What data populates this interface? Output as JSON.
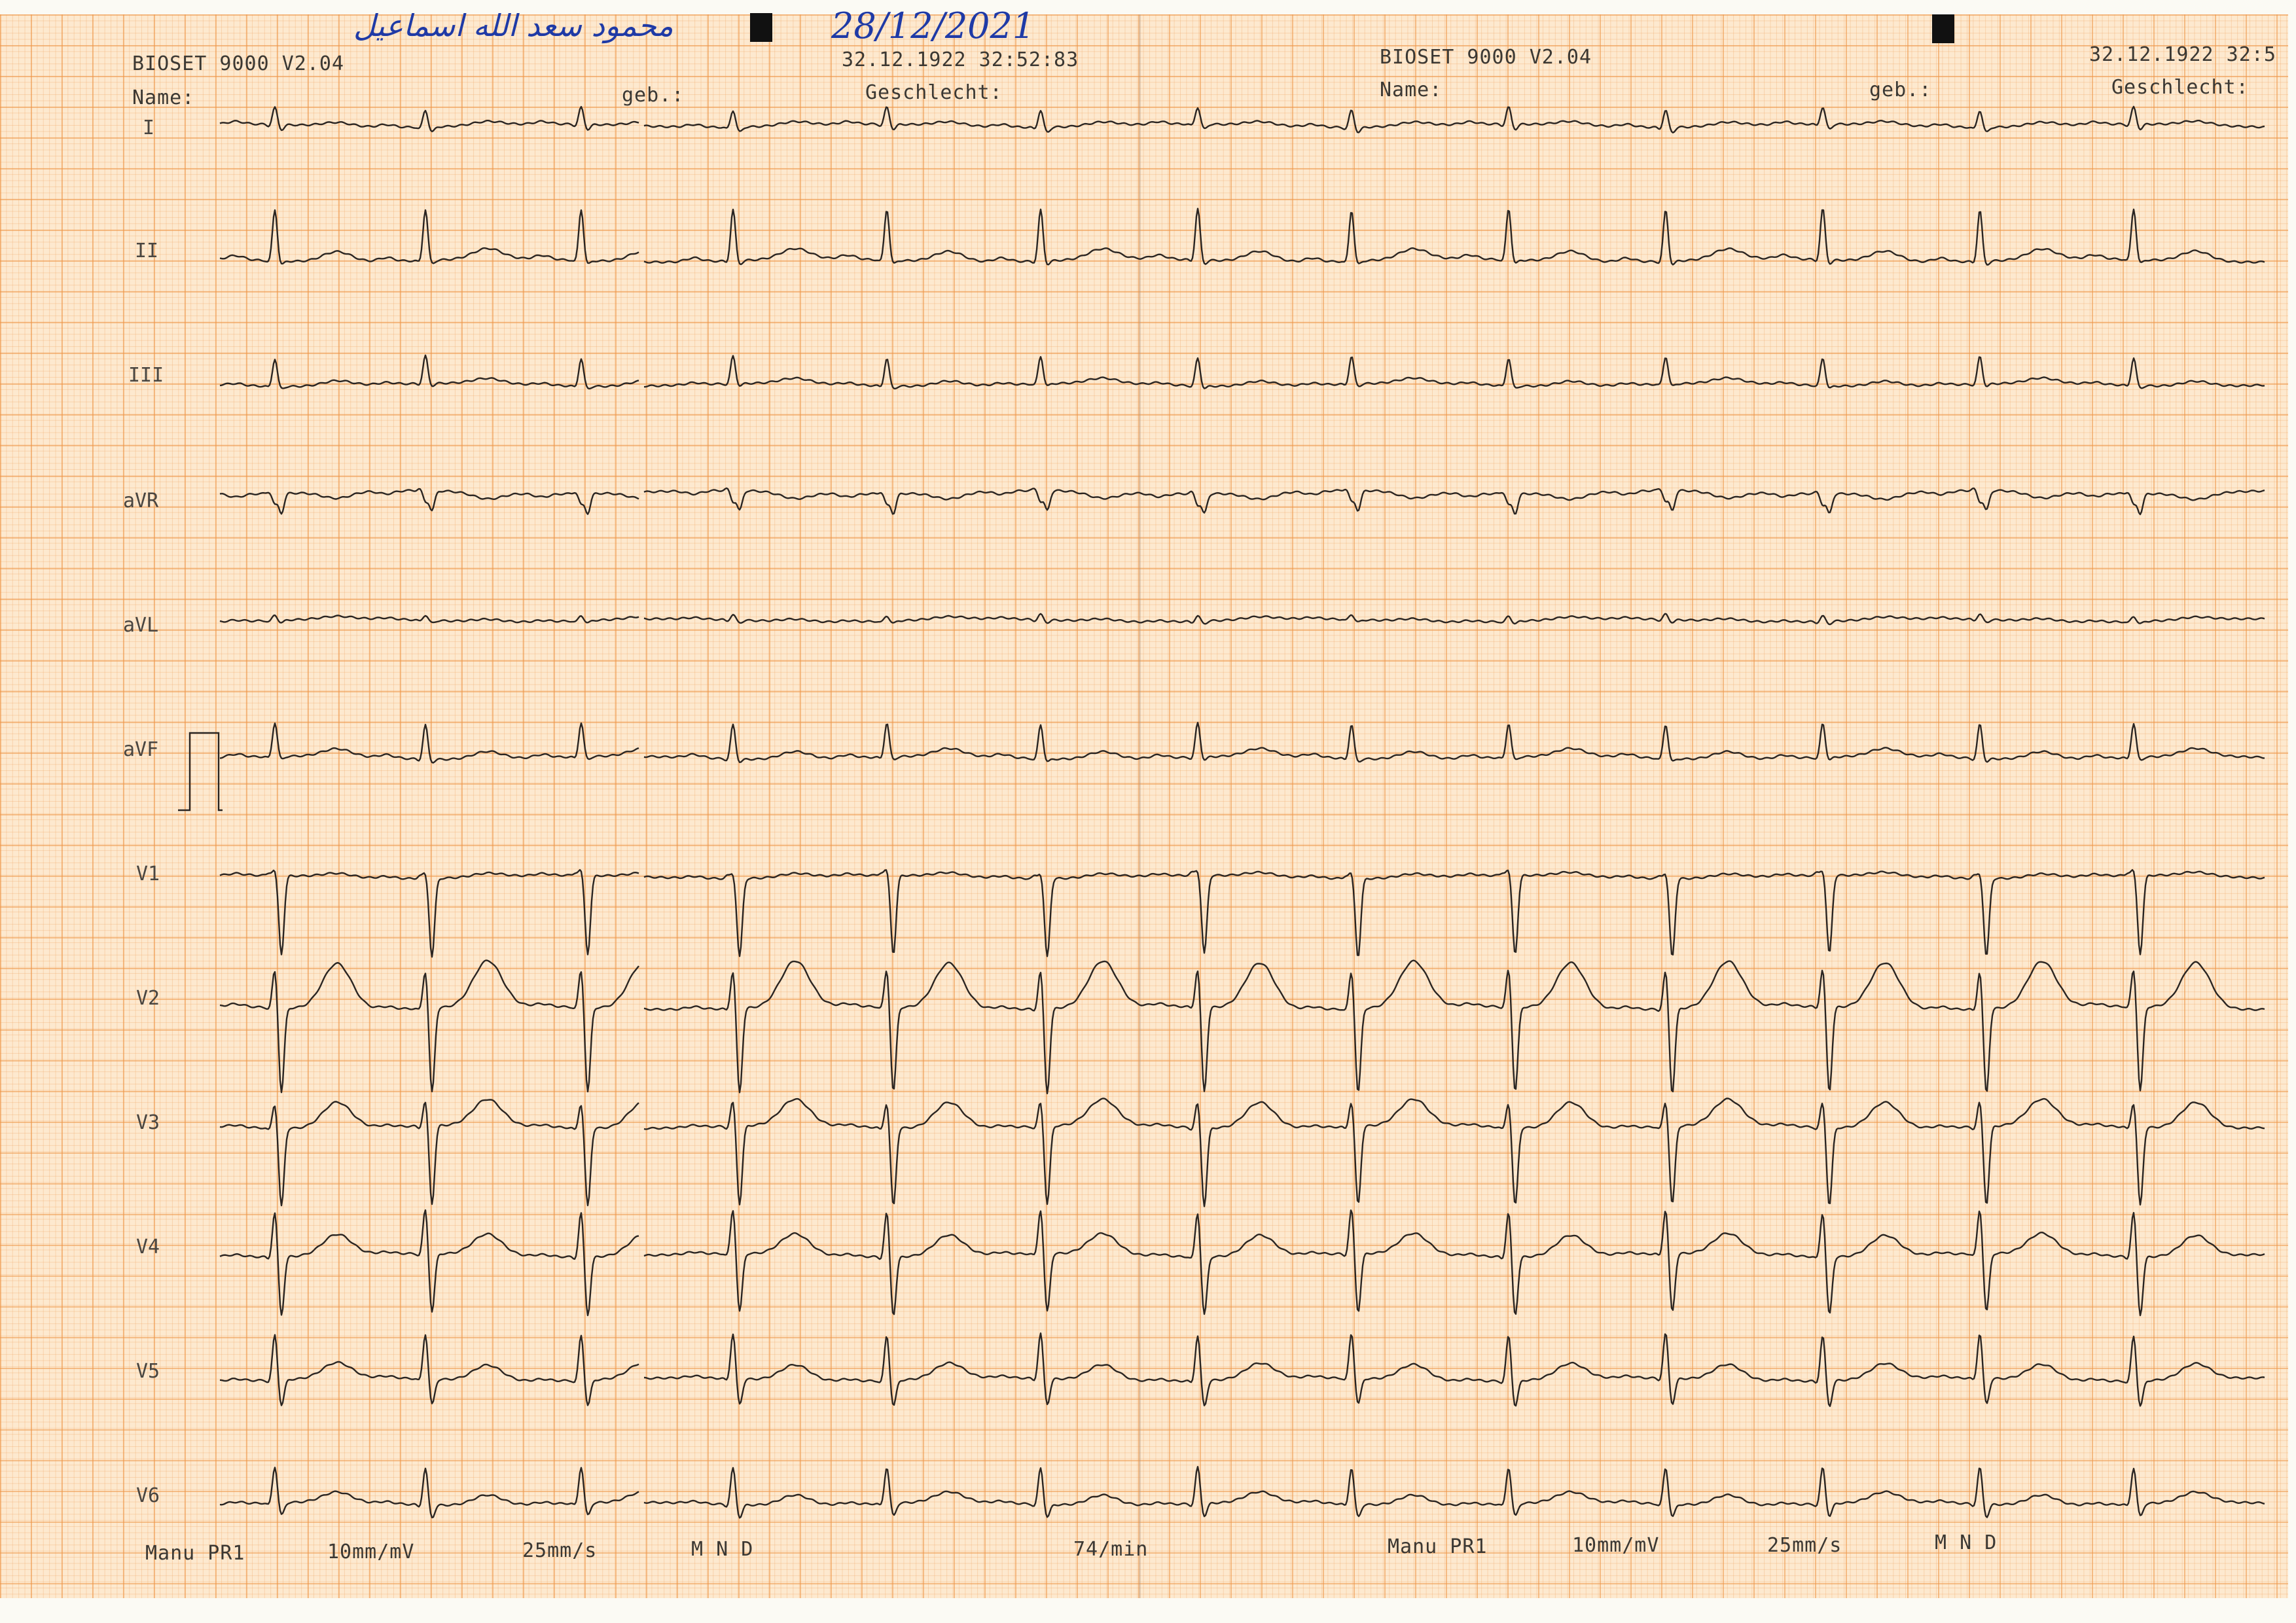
{
  "handwriting": {
    "patient_name": "محمود سعد الله اسماعيل",
    "date": "28/12/2021"
  },
  "header_left": {
    "device": "BIOSET 9000 V2.04",
    "name_label": "Name:",
    "dob_label": "geb.:",
    "datetime": "32.12.1922 32:52:83",
    "sex_label": "Geschlecht:"
  },
  "header_right": {
    "device": "BIOSET 9000 V2.04",
    "name_label": "Name:",
    "dob_label": "geb.:",
    "datetime": "32.12.1922 32:5",
    "sex_label": "Geschlecht:"
  },
  "leads": [
    "I",
    "II",
    "III",
    "aVR",
    "aVL",
    "aVF",
    "V1",
    "V2",
    "V3",
    "V4",
    "V5",
    "V6"
  ],
  "footer_left": {
    "mode": "Manu PR1",
    "gain": "10mm/mV",
    "speed": "25mm/s",
    "filters": "M  N  D",
    "heart_rate": "74/min"
  },
  "footer_right": {
    "mode": "Manu PR1",
    "gain": "10mm/mV",
    "speed": "25mm/s",
    "filters": "M  N  D"
  },
  "colors": {
    "paper": "#fde9cf",
    "grid_major": "#ee9648",
    "trace": "#2a2522",
    "handwriting": "#1f3aa6"
  }
}
